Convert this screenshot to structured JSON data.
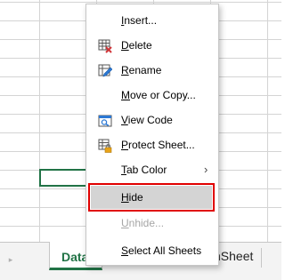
{
  "context_menu": {
    "items": [
      {
        "pre": "",
        "key": "I",
        "post": "nsert...",
        "icon": "",
        "disabled": false
      },
      {
        "pre": "",
        "key": "D",
        "post": "elete",
        "icon": "delete-sheet-icon",
        "disabled": false
      },
      {
        "pre": "",
        "key": "R",
        "post": "ename",
        "icon": "rename-sheet-icon",
        "disabled": false
      },
      {
        "pre": "",
        "key": "M",
        "post": "ove or Copy...",
        "icon": "",
        "disabled": false
      },
      {
        "pre": "",
        "key": "V",
        "post": "iew Code",
        "icon": "view-code-icon",
        "disabled": false
      },
      {
        "pre": "",
        "key": "P",
        "post": "rotect Sheet...",
        "icon": "protect-sheet-icon",
        "disabled": false
      },
      {
        "pre": "",
        "key": "T",
        "post": "ab Color",
        "icon": "",
        "disabled": false,
        "submenu": "›"
      },
      {
        "pre": "",
        "key": "H",
        "post": "ide",
        "icon": "",
        "disabled": false,
        "highlighted": true
      },
      {
        "pre": "",
        "key": "U",
        "post": "nhide...",
        "icon": "",
        "disabled": true
      },
      {
        "pre": "",
        "key": "S",
        "post": "elect All Sheets",
        "icon": "",
        "disabled": false
      }
    ]
  },
  "sheet_tabs": {
    "scroll_arrow": "▸",
    "active": "Data",
    "other_visible": "nSheet"
  },
  "colors": {
    "accent_green": "#217346",
    "highlight_outline": "#e00000",
    "highlight_fill": "#d4d4d4"
  }
}
